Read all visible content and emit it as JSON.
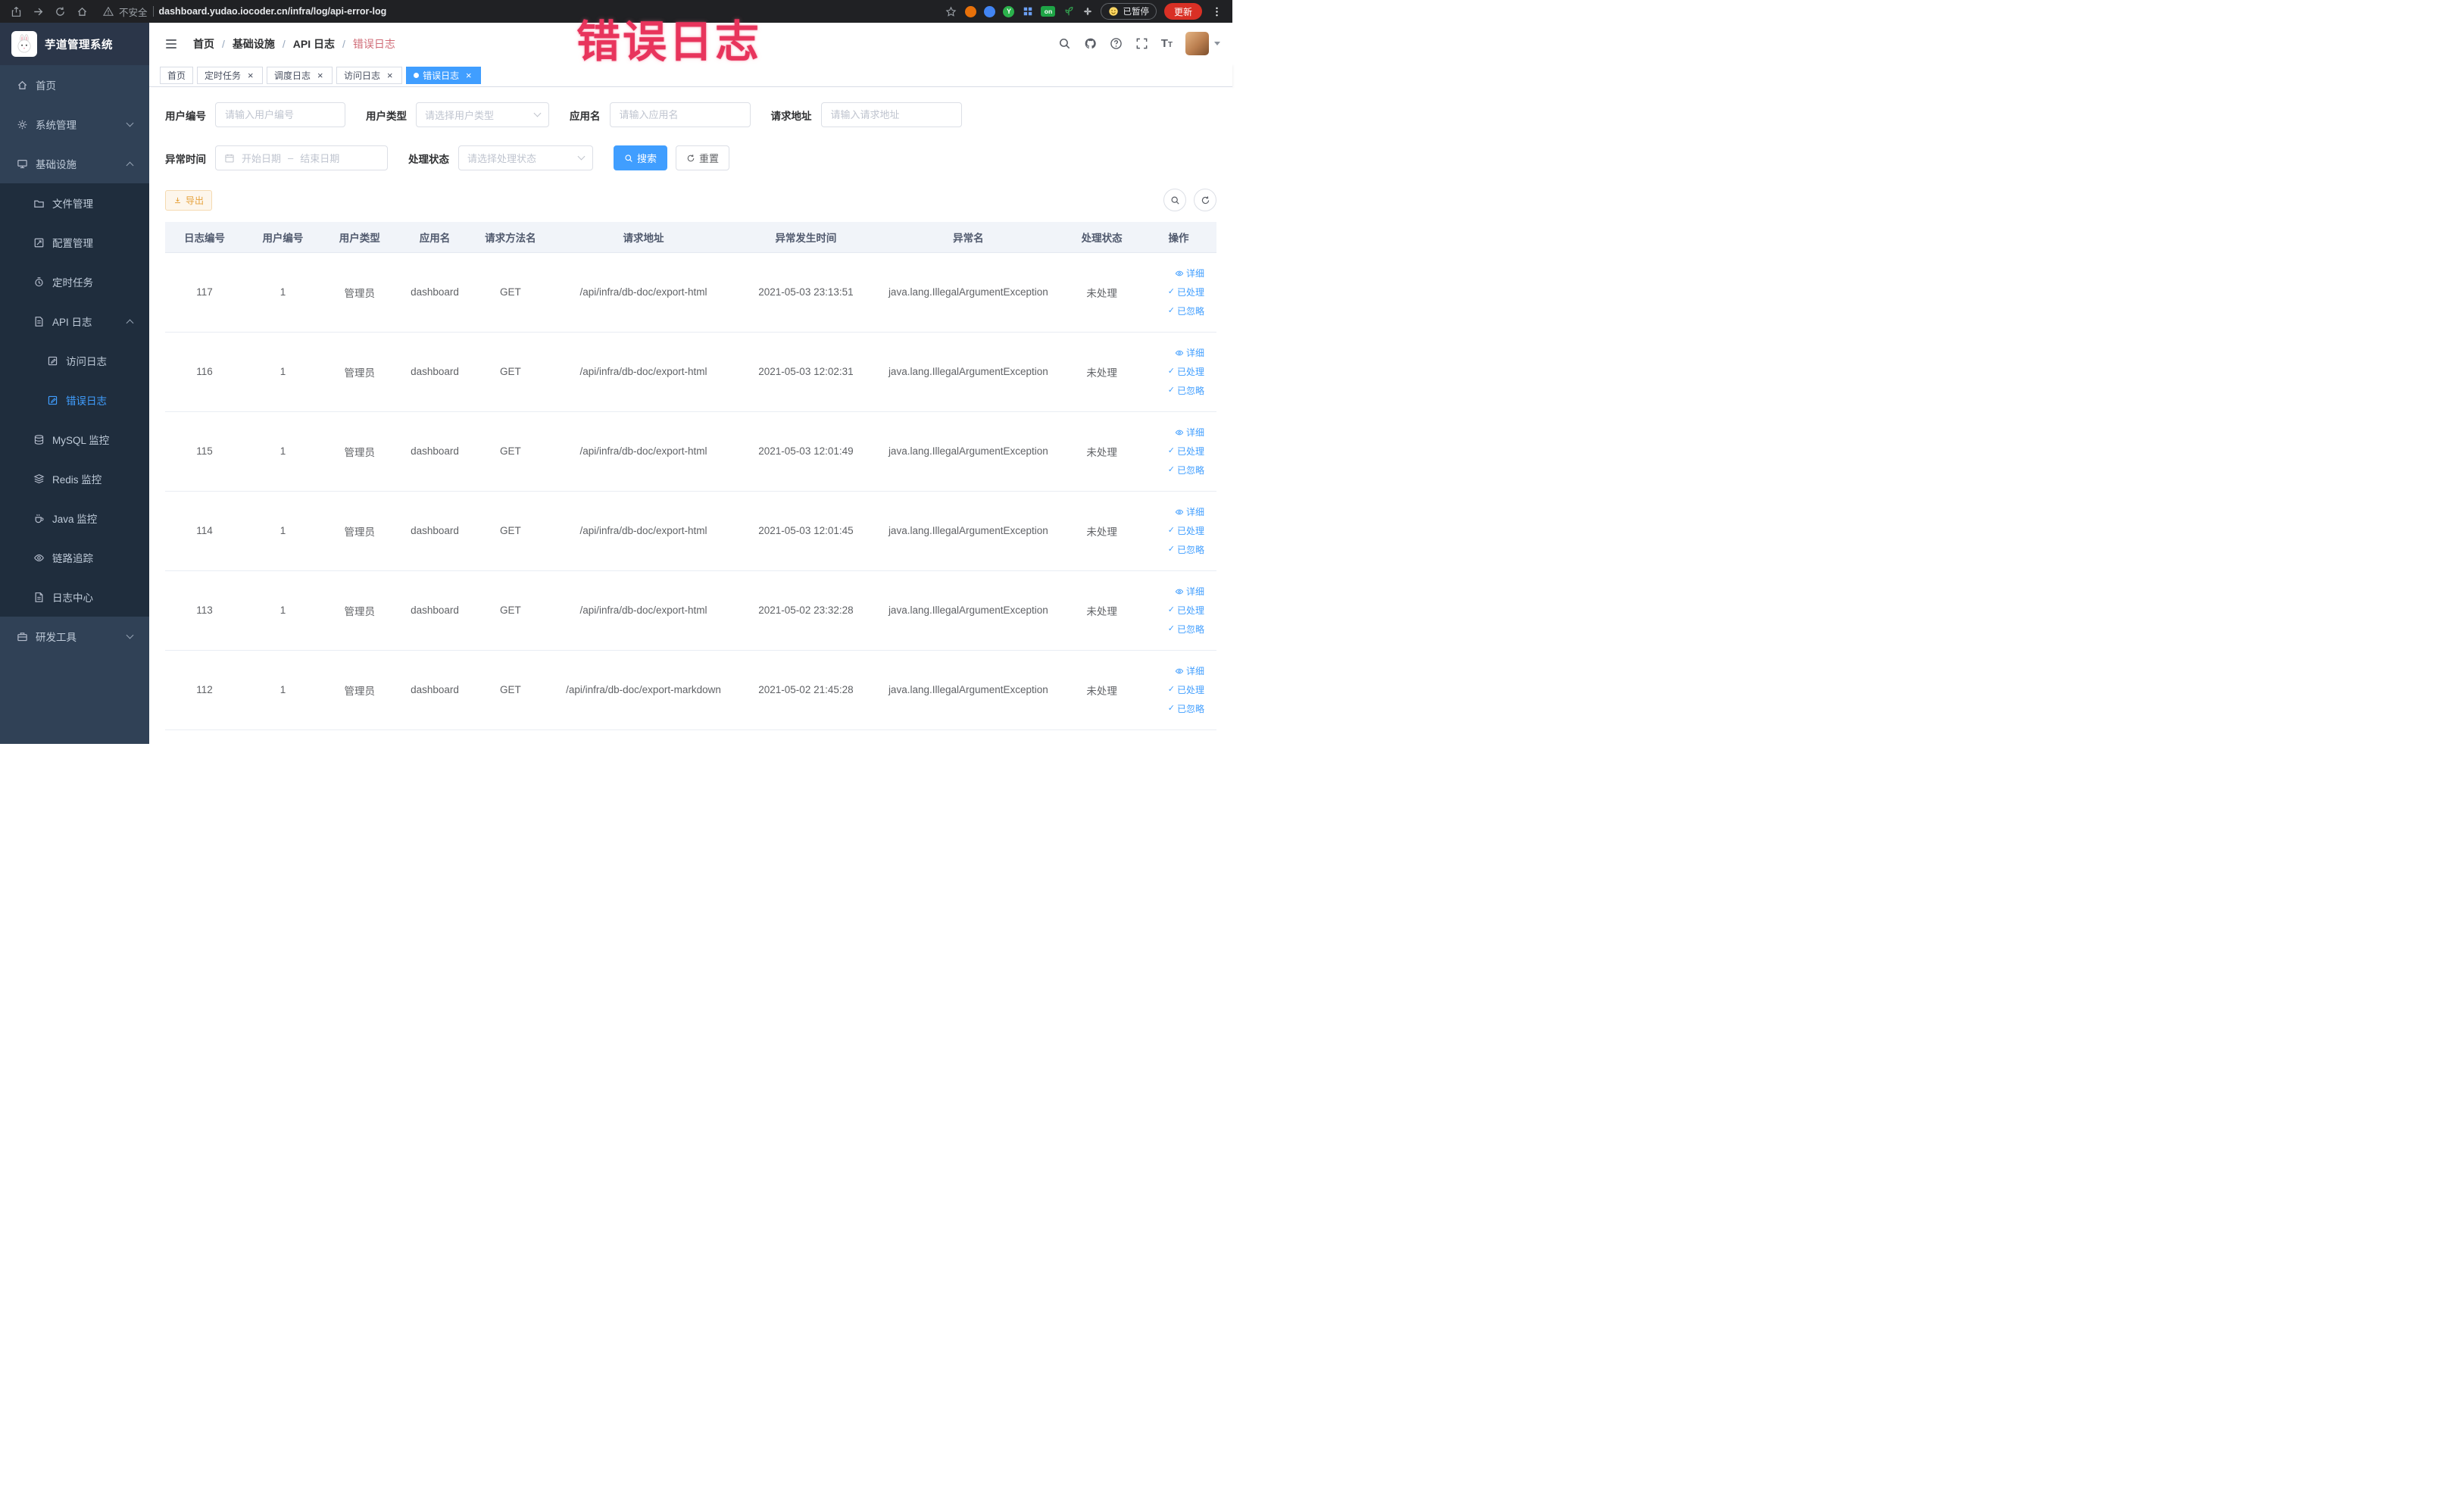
{
  "browser": {
    "security_label": "不安全",
    "url": "dashboard.yudao.iocoder.cn/infra/log/api-error-log",
    "paused_label": "已暂停",
    "update_label": "更新",
    "on_badge": "on"
  },
  "watermark": "错误日志",
  "icons": {
    "close": "×",
    "check": "✓",
    "fontsize_large": "T",
    "fontsize_small": "T",
    "ext_y": "Y"
  },
  "colors": {
    "accent_blue": "#409eff",
    "sidebar_bg": "#304156",
    "submenu_bg": "#1f2d3d",
    "active_tab_bg": "#409eff",
    "export_yellow": "#e6a23c",
    "watermark_red": "#e8345c",
    "table_header_bg": "#f1f4f9"
  },
  "sidebar": {
    "logo_title": "芋道管理系统",
    "items": [
      {
        "label": "首页",
        "icon": "home-icon",
        "cls": "lvl1"
      },
      {
        "label": "系统管理",
        "icon": "gear-icon",
        "cls": "lvl1",
        "chevron": "down"
      },
      {
        "label": "基础设施",
        "icon": "infra-icon",
        "cls": "lvl1",
        "chevron": "up"
      },
      {
        "label": "文件管理",
        "icon": "folder-icon",
        "cls": "lvl2"
      },
      {
        "label": "配置管理",
        "icon": "config-icon",
        "cls": "lvl2"
      },
      {
        "label": "定时任务",
        "icon": "timer-icon",
        "cls": "lvl2"
      },
      {
        "label": "API 日志",
        "icon": "apilog-icon",
        "cls": "lvl2",
        "chevron": "up"
      },
      {
        "label": "访问日志",
        "icon": "doc-icon",
        "cls": "lvl3"
      },
      {
        "label": "错误日志",
        "icon": "doc-icon",
        "cls": "lvl3",
        "active": true
      },
      {
        "label": "MySQL 监控",
        "icon": "mysql-icon",
        "cls": "lvl2"
      },
      {
        "label": "Redis 监控",
        "icon": "redis-icon",
        "cls": "lvl2"
      },
      {
        "label": "Java 监控",
        "icon": "java-icon",
        "cls": "lvl2"
      },
      {
        "label": "链路追踪",
        "icon": "trace-icon",
        "cls": "lvl2"
      },
      {
        "label": "日志中心",
        "icon": "logcenter-icon",
        "cls": "lvl2"
      },
      {
        "label": "研发工具",
        "icon": "tool-icon",
        "cls": "lvl1",
        "chevron": "down"
      }
    ]
  },
  "navbar": {
    "breadcrumb": [
      "首页",
      "基础设施",
      "API 日志",
      "错误日志"
    ]
  },
  "tabs": [
    {
      "label": "首页"
    },
    {
      "label": "定时任务",
      "closable": true
    },
    {
      "label": "调度日志",
      "closable": true
    },
    {
      "label": "访问日志",
      "closable": true
    },
    {
      "label": "错误日志",
      "closable": true,
      "active": true
    }
  ],
  "filters": {
    "user_id_label": "用户编号",
    "user_id_placeholder": "请输入用户编号",
    "user_type_label": "用户类型",
    "user_type_placeholder": "请选择用户类型",
    "app_name_label": "应用名",
    "app_name_placeholder": "请输入应用名",
    "request_url_label": "请求地址",
    "request_url_placeholder": "请输入请求地址",
    "exception_time_label": "异常时间",
    "start_date_placeholder": "开始日期",
    "range_separator": "–",
    "end_date_placeholder": "结束日期",
    "process_status_label": "处理状态",
    "process_status_placeholder": "请选择处理状态",
    "search_button": "搜索",
    "reset_button": "重置"
  },
  "toolbar": {
    "export_button": "导出"
  },
  "table": {
    "headers": [
      "日志编号",
      "用户编号",
      "用户类型",
      "应用名",
      "请求方法名",
      "请求地址",
      "异常发生时间",
      "异常名",
      "处理状态",
      "操作"
    ],
    "actions": {
      "detail": "详细",
      "done": "已处理",
      "ignore": "已忽略"
    },
    "rows": [
      {
        "id": "117",
        "user_id": "1",
        "user_type": "管理员",
        "app": "dashboard",
        "method": "GET",
        "url": "/api/infra/db-doc/export-html",
        "time": "2021-05-03 23:13:51",
        "exception": "java.lang.IllegalArgumentException",
        "status": "未处理"
      },
      {
        "id": "116",
        "user_id": "1",
        "user_type": "管理员",
        "app": "dashboard",
        "method": "GET",
        "url": "/api/infra/db-doc/export-html",
        "time": "2021-05-03 12:02:31",
        "exception": "java.lang.IllegalArgumentException",
        "status": "未处理"
      },
      {
        "id": "115",
        "user_id": "1",
        "user_type": "管理员",
        "app": "dashboard",
        "method": "GET",
        "url": "/api/infra/db-doc/export-html",
        "time": "2021-05-03 12:01:49",
        "exception": "java.lang.IllegalArgumentException",
        "status": "未处理"
      },
      {
        "id": "114",
        "user_id": "1",
        "user_type": "管理员",
        "app": "dashboard",
        "method": "GET",
        "url": "/api/infra/db-doc/export-html",
        "time": "2021-05-03 12:01:45",
        "exception": "java.lang.IllegalArgumentException",
        "status": "未处理"
      },
      {
        "id": "113",
        "user_id": "1",
        "user_type": "管理员",
        "app": "dashboard",
        "method": "GET",
        "url": "/api/infra/db-doc/export-html",
        "time": "2021-05-02 23:32:28",
        "exception": "java.lang.IllegalArgumentException",
        "status": "未处理"
      },
      {
        "id": "112",
        "user_id": "1",
        "user_type": "管理员",
        "app": "dashboard",
        "method": "GET",
        "url": "/api/infra/db-doc/export-markdown",
        "time": "2021-05-02 21:45:28",
        "exception": "java.lang.IllegalArgumentException",
        "status": "未处理"
      }
    ]
  }
}
